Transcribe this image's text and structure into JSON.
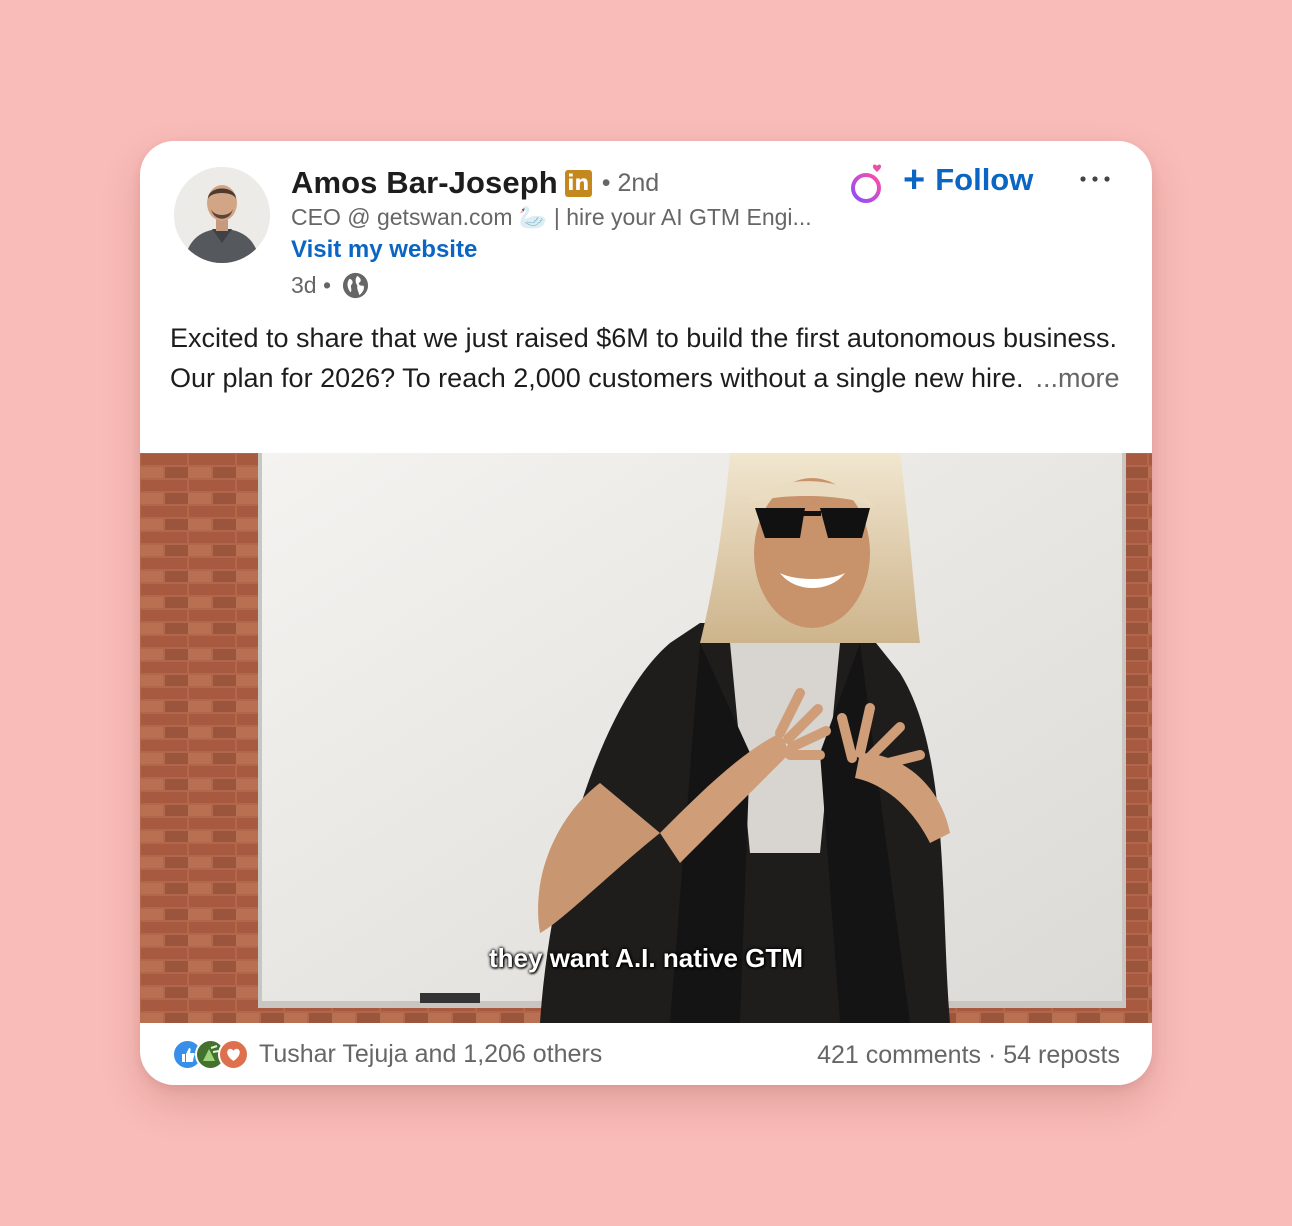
{
  "post": {
    "author": {
      "name": "Amos Bar-Joseph",
      "badge": "in",
      "degree": "• 2nd",
      "headline": "CEO @ getswan.com 🦢 | hire your AI GTM Engi...",
      "website_link": "Visit my website",
      "time": "3d •",
      "visibility_icon": "globe-icon"
    },
    "actions": {
      "follow_label": "Follow",
      "follow_plus": "+",
      "more_icon": "ellipsis-icon"
    },
    "text": "Excited to share that we just raised $6M to build the first autonomous business. Our plan for 2026? To reach 2,000 customers without a single new hire.",
    "more_label": "...more",
    "media": {
      "caption": "they want A.I. native GTM"
    },
    "social": {
      "reaction_icons": [
        "like-icon",
        "celebrate-icon",
        "love-icon"
      ],
      "reactions_text": "Tushar Tejuja and 1,206 others",
      "comments": "421 comments",
      "separator": " · ",
      "reposts": "54 reposts"
    }
  },
  "colors": {
    "background": "#f9bcb8",
    "link_blue": "#0a66c2",
    "badge_gold": "#c4881e",
    "muted_text": "#666666"
  }
}
